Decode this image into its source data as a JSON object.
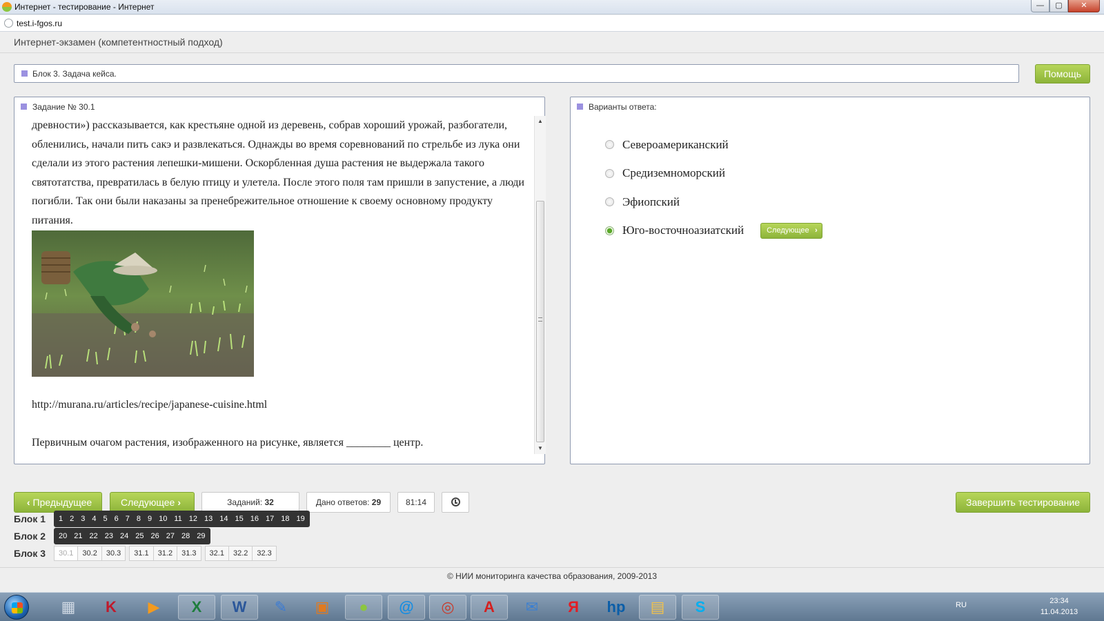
{
  "window": {
    "title": "Интернет - тестирование - Интернет",
    "url": "test.i-fgos.ru",
    "buttons": {
      "minimize": "—",
      "maximize": "▢",
      "close": "✕"
    }
  },
  "app": {
    "title": "Интернет-экзамен (компетентностный подход)",
    "block_title": "Блок 3. Задача кейса.",
    "help_label": "Помощь"
  },
  "task": {
    "heading": "Задание № 30.1",
    "paragraph": "древности») рассказывается, как крестьяне одной из деревень, собрав хороший урожай, разбогатели, обленились, начали пить сакэ и развлекаться. Однажды во время соревнований по стрельбе из лука они сделали из этого растения лепешки-мишени. Оскорбленная душа растения не выдержала такого святотатства, превратилась в белую птицу и улетела. После этого поля там пришли в запустение, а люди погибли. Так они были наказаны за пренебрежительное отношение к своему основному продукту питания.",
    "source_url": "http://murana.ru/articles/recipe/japanese-cuisine.html",
    "question": "Первичным очагом растения, изображенного на рисунке, является ________ центр."
  },
  "answers": {
    "heading": "Варианты ответа:",
    "options": [
      {
        "label": "Североамериканский",
        "selected": false
      },
      {
        "label": "Средиземноморский",
        "selected": false
      },
      {
        "label": "Эфиопский",
        "selected": false
      },
      {
        "label": "Юго-восточноазиатский",
        "selected": true
      }
    ],
    "next_small_label": "Следующее"
  },
  "nav": {
    "prev_label": "Предыдущее",
    "next_label": "Следующее",
    "tasks_label": "Заданий:",
    "tasks_count": "32",
    "answered_label": "Дано ответов:",
    "answered_count": "29",
    "timer": "81:14",
    "finish_label": "Завершить тестирование"
  },
  "blocks": [
    {
      "label": "Блок 1",
      "items": [
        "1",
        "2",
        "3",
        "4",
        "5",
        "6",
        "7",
        "8",
        "9",
        "10",
        "11",
        "12",
        "13",
        "14",
        "15",
        "16",
        "17",
        "18",
        "19"
      ]
    },
    {
      "label": "Блок 2",
      "items": [
        "20",
        "21",
        "22",
        "23",
        "24",
        "25",
        "26",
        "27",
        "28",
        "29"
      ]
    },
    {
      "label": "Блок 3",
      "groups": [
        [
          "30.1",
          "30.2",
          "30.3"
        ],
        [
          "31.1",
          "31.2",
          "31.3"
        ],
        [
          "32.1",
          "32.2",
          "32.3"
        ]
      ],
      "active": "30.1"
    }
  ],
  "footer": "© НИИ мониторинга качества образования, 2009-2013",
  "taskbar": {
    "lang": "RU",
    "time": "23:34",
    "date": "11.04.2013",
    "apps": [
      "calculator-icon",
      "kaspersky-icon",
      "media-player-icon",
      "excel-icon",
      "word-icon",
      "drawing-icon",
      "gallery-icon",
      "browser-icon",
      "mail-ru-icon",
      "cd-burner-icon",
      "acrobat-icon",
      "mail-icon",
      "yandex-icon",
      "hp-icon",
      "explorer-icon",
      "skype-icon"
    ]
  },
  "colors": {
    "accent_green": "#8db43a",
    "radio_selected": "#5aa82a",
    "marker_violet": "#9b91e0"
  }
}
